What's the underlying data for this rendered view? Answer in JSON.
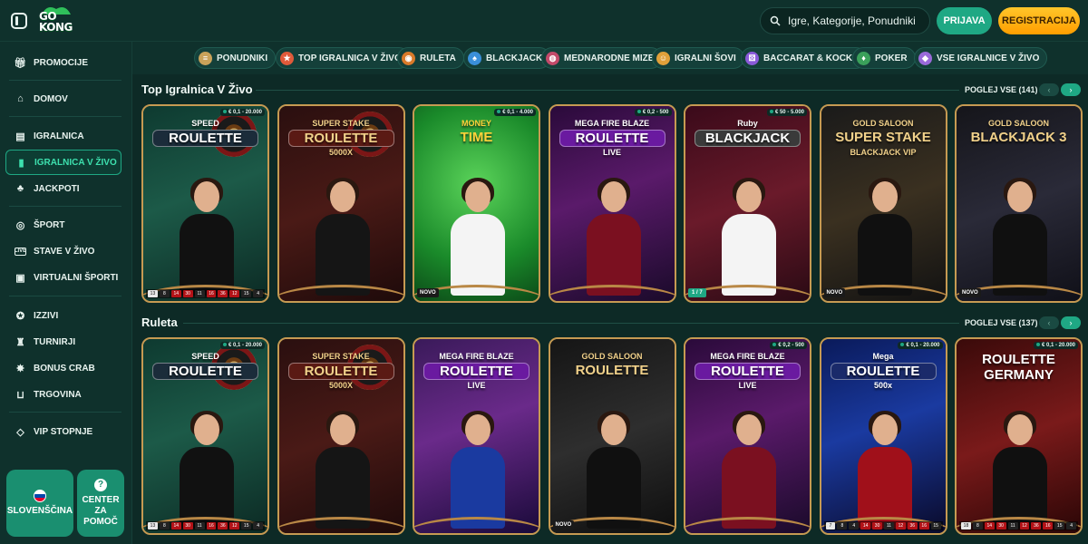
{
  "header": {
    "logo_line1": "GO",
    "logo_line2": "KONG",
    "search_placeholder": "Igre, Kategorije, Ponudniki",
    "login_label": "PRIJAVA",
    "register_label": "REGISTRACIJA"
  },
  "sidebar": {
    "items": [
      {
        "label": "PROMOCIJE",
        "icon": "gift-icon"
      },
      {
        "label": "DOMOV",
        "icon": "home-icon"
      },
      {
        "label": "IGRALNICA",
        "icon": "slot-machine-icon"
      },
      {
        "label": "IGRALNICA V ŽIVO",
        "icon": "live-casino-icon",
        "active": true
      },
      {
        "label": "JACKPOTI",
        "icon": "clover-icon"
      },
      {
        "label": "ŠPORT",
        "icon": "basketball-icon"
      },
      {
        "label": "STAVE V ŽIVO",
        "icon": "live-icon"
      },
      {
        "label": "VIRTUALNI ŠPORTI",
        "icon": "virtual-sports-icon"
      },
      {
        "label": "IZZIVI",
        "icon": "medal-icon"
      },
      {
        "label": "TURNIRJI",
        "icon": "trophy-icon"
      },
      {
        "label": "BONUS CRAB",
        "icon": "crab-icon"
      },
      {
        "label": "TRGOVINA",
        "icon": "basket-icon"
      },
      {
        "label": "VIP STOPNJE",
        "icon": "diamond-icon"
      }
    ],
    "language_label": "SLOVENŠČINA",
    "help_line1": "CENTER",
    "help_line2": "ZA",
    "help_line3": "POMOČ"
  },
  "categories": [
    {
      "label": "PONUDNIKI",
      "icon": "scroll-icon",
      "color": "#c9a25a"
    },
    {
      "label": "TOP IGRALNICA V ŽIVO",
      "icon": "star-icon",
      "color": "#e05a3a"
    },
    {
      "label": "RULETA",
      "icon": "roulette-icon",
      "color": "#d97a2a"
    },
    {
      "label": "BLACKJACK",
      "icon": "cards-icon",
      "color": "#3a8fd9"
    },
    {
      "label": "MEDNARODNE MIZE",
      "icon": "globe-icon",
      "color": "#c24a6a"
    },
    {
      "label": "IGRALNI ŠOVI",
      "icon": "show-icon",
      "color": "#e0a03a"
    },
    {
      "label": "BACCARAT & KOCKE",
      "icon": "dice-icon",
      "color": "#8a5ad9"
    },
    {
      "label": "POKER",
      "icon": "poker-icon",
      "color": "#3aa05a"
    },
    {
      "label": "VSE IGRALNICE V ŽIVO",
      "icon": "all-games-icon",
      "color": "#9a6ad9"
    }
  ],
  "sections": [
    {
      "title": "Top Igralnica V Živo",
      "see_all": "POGLEJ VSE (141)",
      "tiles": [
        {
          "title1": "SPEED",
          "title2": "ROULETTE",
          "limit": "€ 0,1 - 20.000",
          "theme": "speed",
          "history": [
            "13",
            "8",
            "14",
            "30",
            "11",
            "16",
            "36",
            "12",
            "15",
            "4"
          ]
        },
        {
          "title1": "SUPER STAKE",
          "title2": "ROULETTE",
          "title3": "5000X",
          "theme": "stake"
        },
        {
          "title1": "MONEY",
          "title2": "TIME",
          "limit": "€ 0,1 - 4.000",
          "theme": "money",
          "badge": "NOVO"
        },
        {
          "title1": "MEGA FIRE BLAZE",
          "title2": "ROULETTE",
          "title3": "LIVE",
          "limit": "€ 0,2 - 500",
          "theme": "mega"
        },
        {
          "title1": "Ruby",
          "title2": "BLACKJACK",
          "limit": "€ 50 - 5.000",
          "theme": "ruby",
          "seats": "1 / 7"
        },
        {
          "title1": "GOLD SALOON",
          "title2": "SUPER STAKE",
          "title3": "BLACKJACK VIP",
          "theme": "gold1",
          "badge": "NOVO"
        },
        {
          "title1": "GOLD SALOON",
          "title2": "BLACKJACK 3",
          "theme": "gold2",
          "badge": "NOVO"
        }
      ]
    },
    {
      "title": "Ruleta",
      "see_all": "POGLEJ VSE (137)",
      "tiles": [
        {
          "title1": "SPEED",
          "title2": "ROULETTE",
          "limit": "€ 0,1 - 20.000",
          "theme": "speed",
          "history": [
            "13",
            "8",
            "14",
            "30",
            "11",
            "16",
            "36",
            "12",
            "15",
            "4"
          ]
        },
        {
          "title1": "SUPER STAKE",
          "title2": "ROULETTE",
          "title3": "5000X",
          "theme": "stake"
        },
        {
          "title1": "MEGA FIRE BLAZE",
          "title2": "ROULETTE",
          "title3": "LIVE",
          "theme": "mega2"
        },
        {
          "title1": "GOLD SALOON",
          "title2": "ROULETTE",
          "theme": "gold3",
          "badge": "NOVO"
        },
        {
          "title1": "MEGA FIRE BLAZE",
          "title2": "ROULETTE",
          "title3": "LIVE",
          "limit": "€ 0,2 - 500",
          "theme": "mega"
        },
        {
          "title1": "Mega",
          "title2": "ROULETTE",
          "title3": "500x",
          "limit": "€ 0,1 - 20.000",
          "theme": "megaroul",
          "history": [
            "7",
            "8",
            "4",
            "14",
            "30",
            "11",
            "12",
            "36",
            "16",
            "15"
          ]
        },
        {
          "title1": "ROULETTE GERMANY",
          "limit": "€ 0,1 - 20.000",
          "theme": "germany",
          "history": [
            "18",
            "8",
            "14",
            "30",
            "11",
            "12",
            "36",
            "16",
            "15",
            "4"
          ]
        }
      ]
    }
  ],
  "colors": {
    "accent": "#1fa884",
    "register": "#ffb000",
    "tile_border": "#c69a52",
    "background": "#0d2a26"
  }
}
